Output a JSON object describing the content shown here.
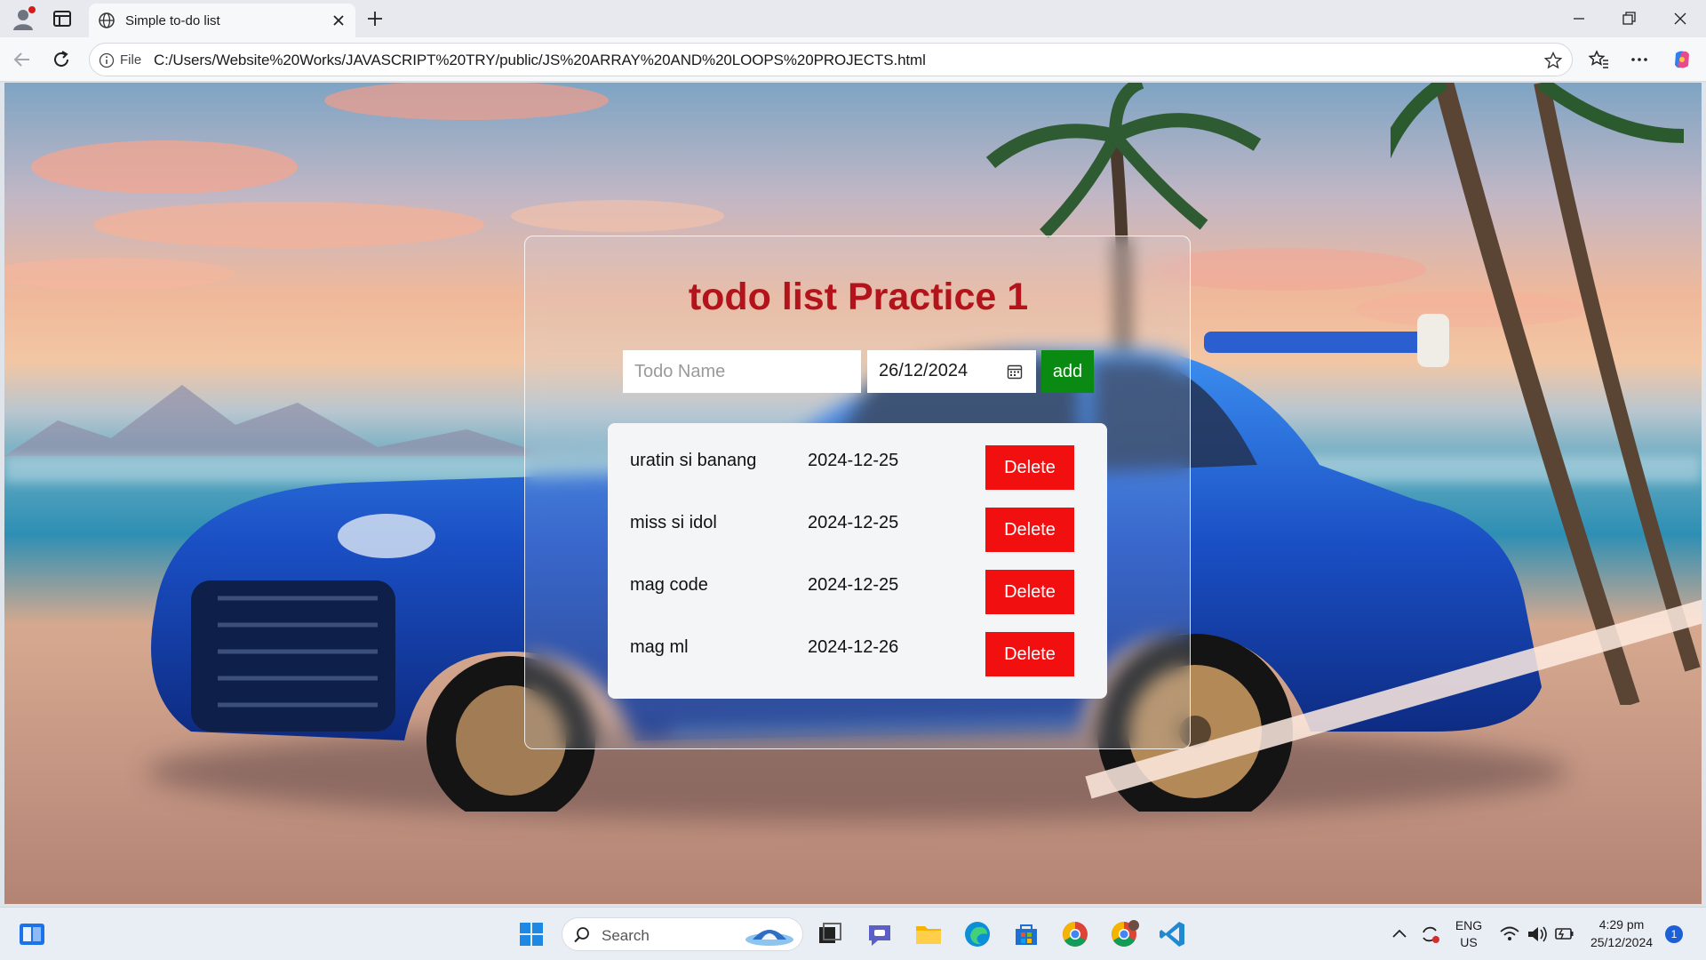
{
  "browser": {
    "tab_title": "Simple to-do list",
    "file_label": "File",
    "url": "C:/Users/Website%20Works/JAVASCRIPT%20TRY/public/JS%20ARRAY%20AND%20LOOPS%20PROJECTS.html"
  },
  "app": {
    "title": "todo list Practice 1",
    "name_placeholder": "Todo Name",
    "name_value": "",
    "date_value": "26/12/2024",
    "add_label": "add",
    "todos": [
      {
        "name": "uratin si banang",
        "date": "2024-12-25",
        "delete_label": "Delete"
      },
      {
        "name": "miss si idol",
        "date": "2024-12-25",
        "delete_label": "Delete"
      },
      {
        "name": "mag code",
        "date": "2024-12-25",
        "delete_label": "Delete"
      },
      {
        "name": "mag ml",
        "date": "2024-12-26",
        "delete_label": "Delete"
      }
    ]
  },
  "taskbar": {
    "search_label": "Search",
    "language_line1": "ENG",
    "language_line2": "US",
    "time": "4:29 pm",
    "date": "25/12/2024",
    "notification_count": "1"
  },
  "colors": {
    "title_red": "#b3141b",
    "add_green": "#0a8a12",
    "delete_red": "#f20f10"
  }
}
